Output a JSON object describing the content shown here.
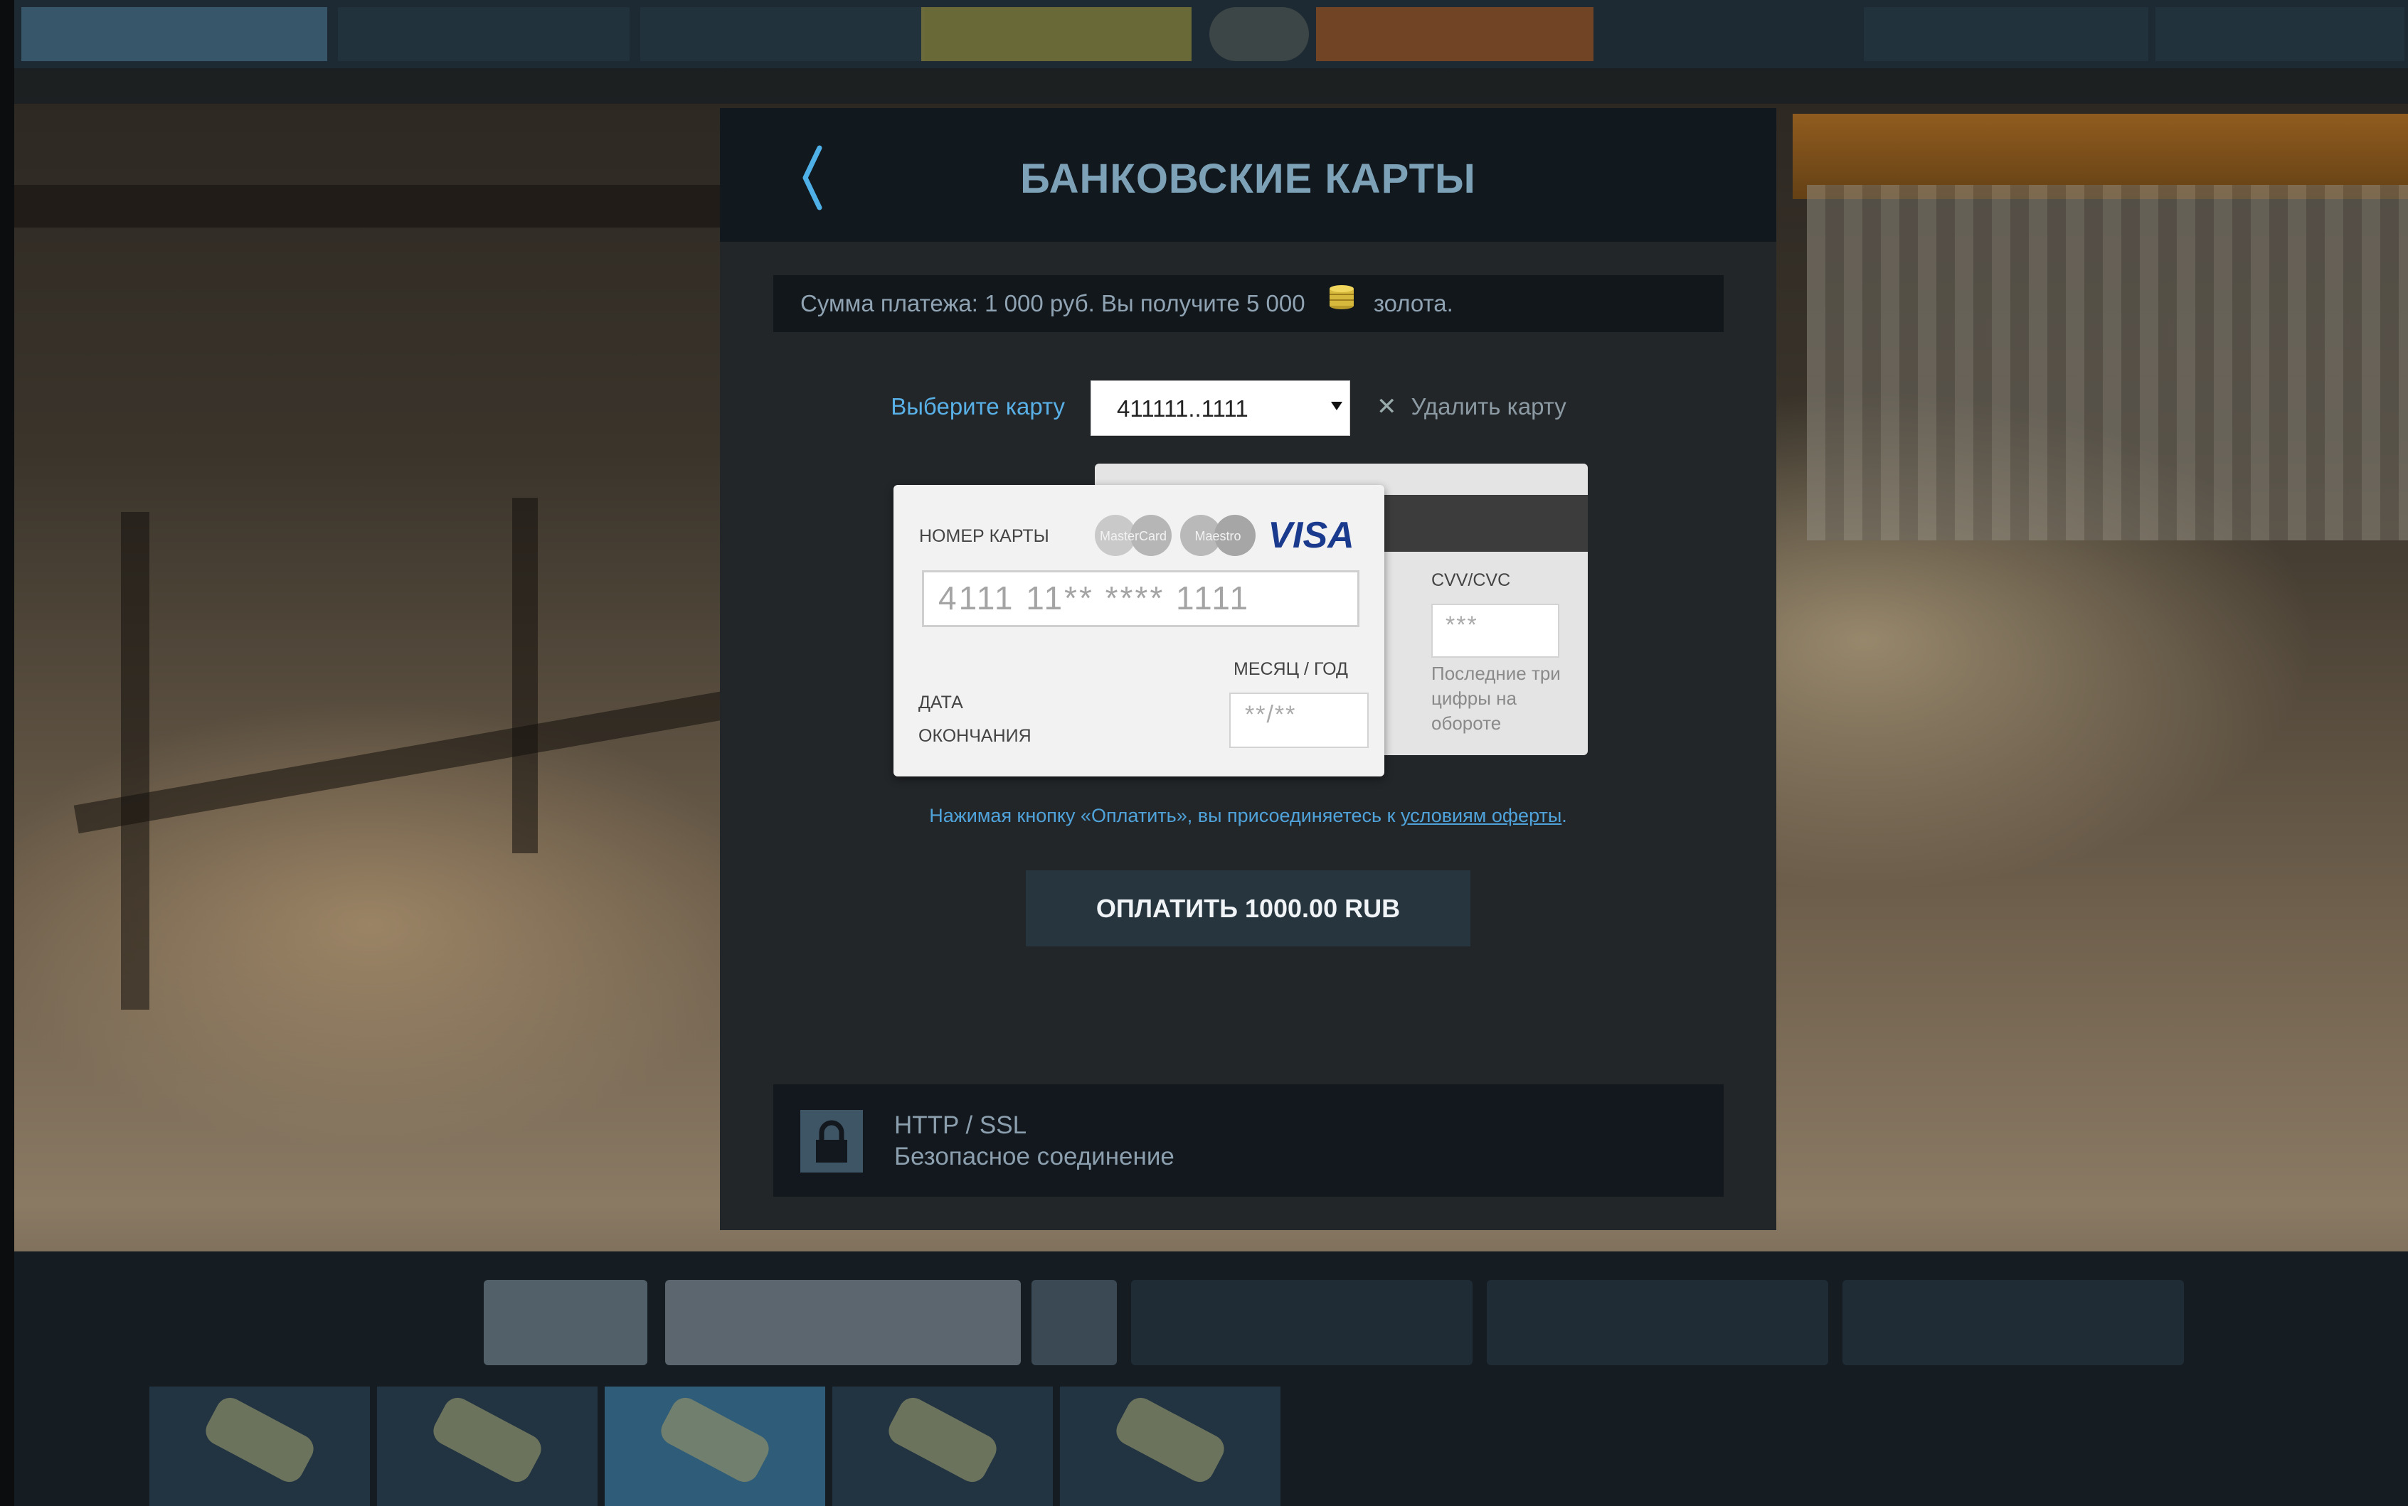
{
  "modal": {
    "title": "БАНКОВСКИЕ КАРТЫ",
    "payment_info": {
      "sum_text": "Сумма платежа: 1 000 руб.  Вы получите 5 000",
      "currency_text": "золота."
    },
    "card_select": {
      "label": "Выберите карту",
      "selected_value": "411111..1111",
      "delete_label": "Удалить карту"
    },
    "card_form": {
      "number_label": "НОМЕР КАРТЫ",
      "number_value": "4111 11** **** 1111",
      "logos": [
        "MasterCard",
        "Maestro",
        "VISA"
      ],
      "expiry_label_line1": "ДАТА",
      "expiry_label_line2": "ОКОНЧАНИЯ",
      "mmyy_label": "МЕСЯЦ / ГОД",
      "expiry_placeholder": "**/**",
      "cvv_label": "CVV/CVC",
      "cvv_placeholder": "***",
      "cvv_help": "Последние три цифры на обороте"
    },
    "terms": {
      "text": "Нажимая кнопку «Оплатить», вы присоединяетесь к",
      "link": "условиям оферты",
      "end": "."
    },
    "pay_button": "ОПЛАТИТЬ 1000.00 RUB",
    "security": {
      "protocol": "HTTP / SSL",
      "label": "Безопасное соединение"
    }
  },
  "colors": {
    "accent": "#58b0e6",
    "title": "#7da2b8",
    "modal_bg": "#232629",
    "header_bg": "#11181e",
    "button_bg": "#27353f"
  },
  "icons": [
    "back-chevron-icon",
    "coin-stack-icon",
    "dropdown-arrow-icon",
    "close-icon",
    "lock-icon",
    "mastercard-logo",
    "maestro-logo",
    "visa-logo"
  ]
}
